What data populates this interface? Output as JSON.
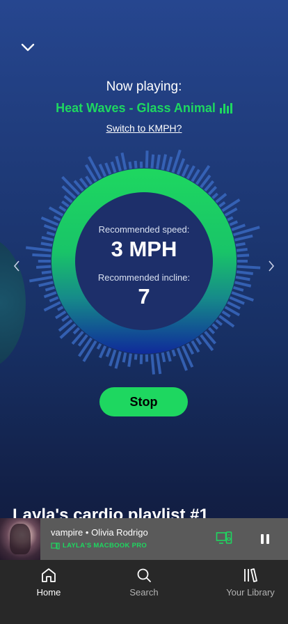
{
  "header": {
    "collapse_icon": "chevron-down-icon",
    "now_playing_label": "Now playing:",
    "track": "Heat Waves - Glass Animal",
    "equalizer_icon": "equalizer-icon",
    "unit_toggle": "Switch to KMPH?"
  },
  "workout": {
    "speed_label": "Recommended speed:",
    "speed_value": "3 MPH",
    "incline_label": "Recommended incline:",
    "incline_value": "7",
    "stop_label": "Stop",
    "prev_icon": "chevron-left-icon",
    "next_icon": "chevron-right-icon"
  },
  "playlist_title": "Layla's cardio playlist #1",
  "mini_player": {
    "song": "vampire",
    "artist": "Olivia Rodrigo",
    "separator": "•",
    "device": "LAYLA'S MACBOOK PRO",
    "devices_icon": "connect-devices-icon",
    "pause_icon": "pause-icon"
  },
  "bottom_nav": {
    "items": [
      {
        "label": "Home",
        "icon": "home-icon",
        "active": true
      },
      {
        "label": "Search",
        "icon": "search-icon",
        "active": false
      },
      {
        "label": "Your Library",
        "icon": "library-icon",
        "active": false
      }
    ]
  },
  "colors": {
    "accent": "#1ed760",
    "background_top": "#26468f",
    "background_bottom": "#0f1a3a",
    "ring_inner": "#1d2f6a",
    "mini_player_bg": "#5a5a5a",
    "nav_bg": "#282828"
  }
}
